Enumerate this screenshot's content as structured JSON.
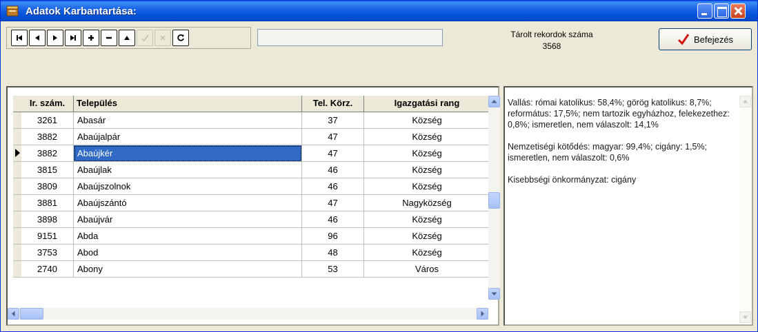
{
  "window": {
    "title": "Adatok Karbantartása:"
  },
  "toolbar": {
    "nav_buttons": [
      "first",
      "prior",
      "next",
      "last",
      "insert",
      "delete",
      "edit",
      "post",
      "cancel",
      "refresh"
    ],
    "record_count_label": "Tárolt rekordok száma",
    "record_count": "3568",
    "finish_label": "Befejezés"
  },
  "grid": {
    "headers": [
      "Ir. szám.",
      "Település",
      "Tel. Körz.",
      "Igazgatási rang"
    ],
    "rows": [
      [
        "3261",
        "Abasár",
        "37",
        "Község"
      ],
      [
        "3882",
        "Abaújalpár",
        "47",
        "Község"
      ],
      [
        "3882",
        "Abaújkér",
        "47",
        "Község"
      ],
      [
        "3815",
        "Abaújlak",
        "46",
        "Község"
      ],
      [
        "3809",
        "Abaújszolnok",
        "46",
        "Község"
      ],
      [
        "3881",
        "Abaújszántó",
        "47",
        "Nagyközség"
      ],
      [
        "3898",
        "Abaújvár",
        "46",
        "Község"
      ],
      [
        "9151",
        "Abda",
        "96",
        "Község"
      ],
      [
        "3753",
        "Abod",
        "48",
        "Község"
      ],
      [
        "2740",
        "Abony",
        "53",
        "Város"
      ]
    ],
    "selected_row": 2
  },
  "info": {
    "paragraphs": [
      "Vallás: római katolikus: 58,4%; görög katolikus: 8,7%; református: 17,5%; nem tartozik egyházhoz, felekezethez: 0,8%; ismeretlen, nem válaszolt: 14,1%",
      "Nemzetiségi kötődés: magyar: 99,4%; cigány: 1,5%; ismeretlen, nem válaszolt: 0,6%",
      "Kisebbségi önkormányzat: cigány"
    ]
  },
  "colors": {
    "titlebar": "#0553d8",
    "selection": "#316ac5",
    "check": "#d21414"
  }
}
